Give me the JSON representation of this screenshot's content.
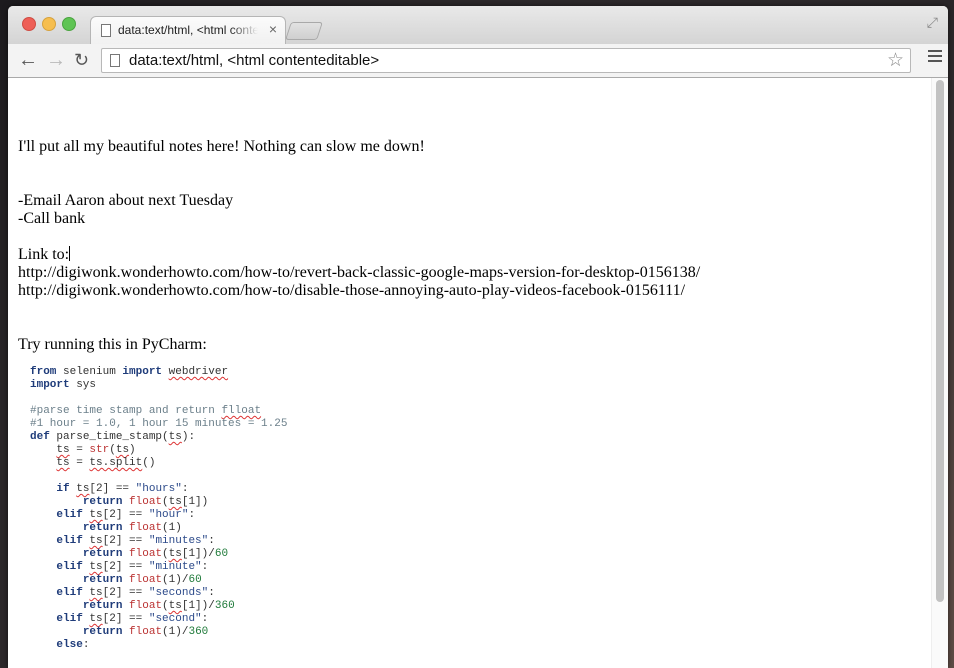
{
  "browser": {
    "tab_title": "data:text/html, <html contenteditable>",
    "tab_close": "×",
    "url": "data:text/html, <html contenteditable>",
    "icons": [
      "back-icon",
      "forward-icon",
      "reload-icon",
      "star-icon",
      "menu-icon",
      "fullscreen-icon",
      "document-icon"
    ]
  },
  "notes": {
    "intro": "I'll put all my beautiful notes here! Nothing can slow me down!",
    "todo1": "-Email Aaron about next Tuesday",
    "todo2": "-Call bank",
    "link_label": "Link to:",
    "link1": "http://digiwonk.wonderhowto.com/how-to/revert-back-classic-google-maps-version-for-desktop-0156138/",
    "link2": "http://digiwonk.wonderhowto.com/how-to/disable-those-annoying-auto-play-videos-facebook-0156111/",
    "pycharm": "Try running this in PyCharm:"
  },
  "code": {
    "l1": [
      "from",
      " selenium ",
      "import",
      " ",
      "webdriver"
    ],
    "l2": [
      "import",
      " sys"
    ],
    "l3": "#parse time stamp and return ",
    "l3b": "flloat",
    "l4": "#1 hour = 1.0, 1 hour 15 minutes = 1.25",
    "l5": [
      "def",
      " parse_time_stamp(",
      "ts",
      "):"
    ],
    "l6": [
      "    ",
      "ts",
      " = ",
      "str",
      "(",
      "ts",
      ")"
    ],
    "l7": [
      "    ",
      "ts",
      " = ",
      "ts.split",
      "()"
    ],
    "c_if": "if",
    "c_elif": "elif",
    "c_else": "else",
    "c_return": "return",
    "c_float": "float",
    "c_ts": "ts",
    "s_hours": "\"hours\"",
    "s_hour": "\"hour\"",
    "s_minutes": "\"minutes\"",
    "s_minute": "\"minute\"",
    "s_seconds": "\"seconds\"",
    "s_second": "\"second\"",
    "n60": "60",
    "n360": "360",
    "idx2": "[2] == ",
    "idx1": "[1])",
    "one": "(1)"
  }
}
